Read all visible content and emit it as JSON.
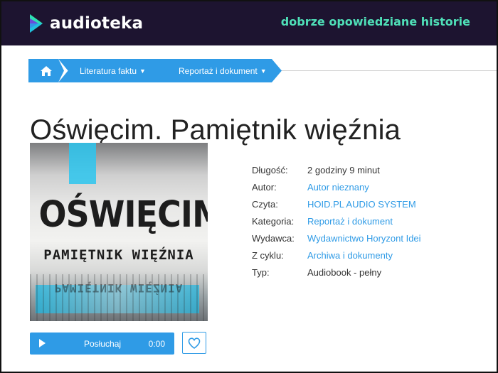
{
  "brand": {
    "name": "audioteka",
    "tagline": "dobrze opowiedziane historie",
    "accent": "#2f9be6",
    "header_bg": "#1d1430",
    "tagline_color": "#4fe0b8"
  },
  "breadcrumb": {
    "home_icon": "home-icon",
    "items": [
      {
        "label": "Literatura faktu"
      },
      {
        "label": "Reportaż i dokument"
      }
    ]
  },
  "book": {
    "title": "Oświęcim. Pamiętnik więźnia",
    "cover": {
      "title": "OŚWIĘCIM",
      "subtitle": "PAMIĘTNIK WIĘŹNIA"
    },
    "details": [
      {
        "key": "Długość:",
        "value": "2 godziny 9 minut",
        "link": false
      },
      {
        "key": "Autor:",
        "value": "Autor nieznany",
        "link": true
      },
      {
        "key": "Czyta:",
        "value": "HOID.PL AUDIO SYSTEM",
        "link": true
      },
      {
        "key": "Kategoria:",
        "value": "Reportaż i dokument",
        "link": true
      },
      {
        "key": "Wydawca:",
        "value": "Wydawnictwo Horyzont Idei",
        "link": true
      },
      {
        "key": "Z cyklu:",
        "value": "Archiwa i dokumenty",
        "link": true
      },
      {
        "key": "Typ:",
        "value": "Audiobook - pełny",
        "link": false
      }
    ]
  },
  "player": {
    "label": "Posłuchaj",
    "time": "0:00",
    "icon": "play-icon"
  },
  "favorite": {
    "icon": "heart-icon"
  }
}
